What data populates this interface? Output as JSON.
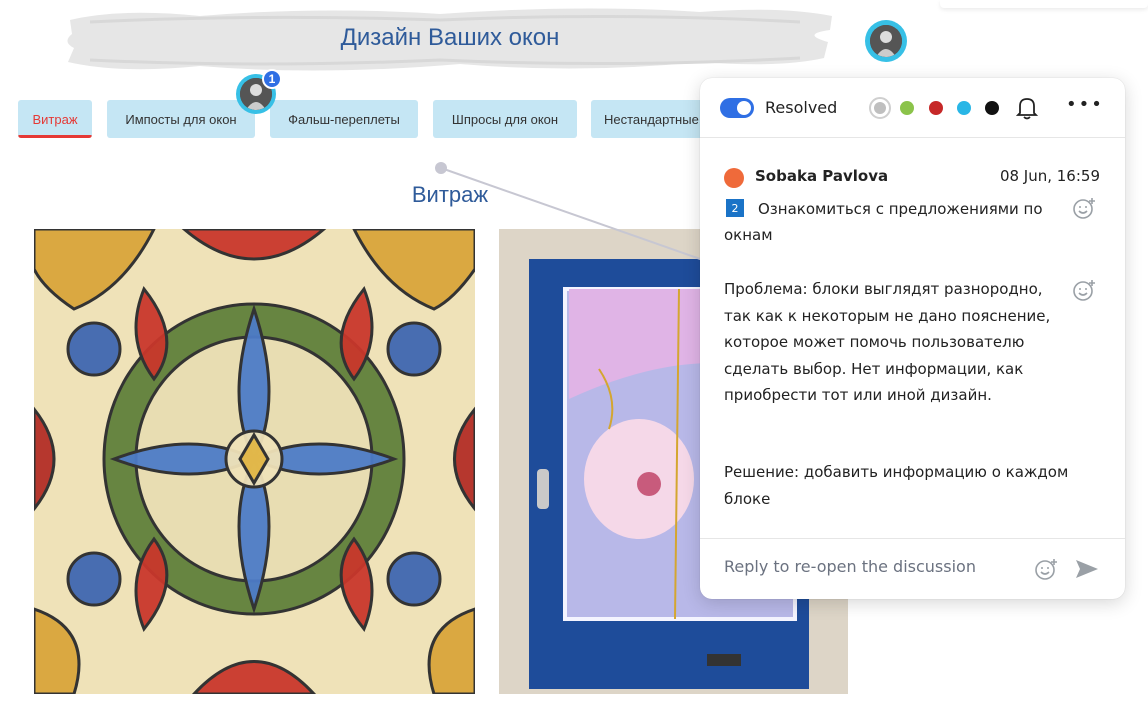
{
  "page": {
    "title": "Дизайн Ваших окон",
    "section_title": "Витраж"
  },
  "tabs": [
    {
      "label": "Витраж",
      "active": true
    },
    {
      "label": "Импосты для окон",
      "active": false
    },
    {
      "label": "Фальш-переплеты",
      "active": false
    },
    {
      "label": "Шпросы для окон",
      "active": false
    },
    {
      "label": "Нестандартные окна",
      "active": false
    }
  ],
  "marker": {
    "count": "1"
  },
  "comment_panel": {
    "status_label": "Resolved",
    "resolved": true,
    "colors": [
      "#bfbfbf",
      "#8bc34a",
      "#c62828",
      "#29b6e6",
      "#111111"
    ],
    "author": "Sobaka Pavlova",
    "timestamp": "08 Jun, 16:59",
    "message_number": "2",
    "message_title": "Ознакомиться с предложениями по окнам",
    "problem": "Проблема: блоки выглядят разнородно, так как к некоторым не дано пояснение, которое может помочь пользователю сделать выбор. Нет информации, как приобрести тот или иной дизайн.",
    "solution": "Решение: добавить информацию о каждом блоке",
    "reply_placeholder": "Reply to re-open the discussion"
  },
  "icons": {
    "bell": "bell-icon",
    "more": "more-icon",
    "emoji_add": "emoji-add-icon",
    "send": "send-icon"
  }
}
